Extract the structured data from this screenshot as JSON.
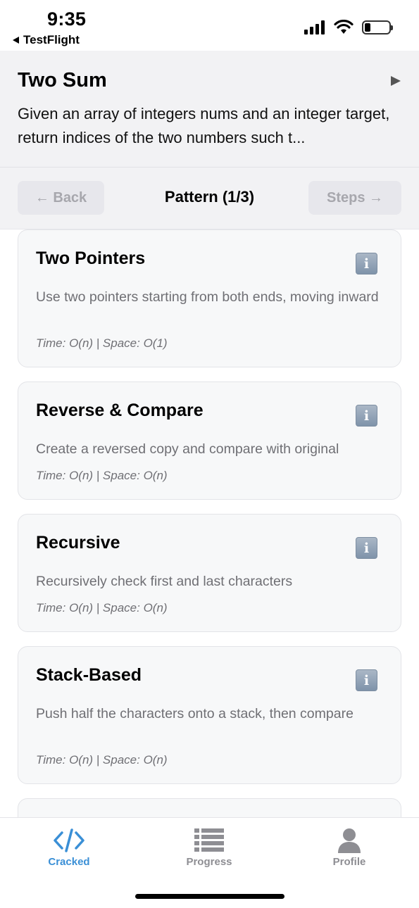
{
  "status_bar": {
    "time": "9:35",
    "back_app_label": "TestFlight",
    "battery_level": 0.25
  },
  "header": {
    "title": "Two Sum",
    "description": "Given an array of integers nums and an integer target, return indices of the two numbers such t..."
  },
  "pattern_nav": {
    "back_label": "← Back",
    "title": "Pattern (1/3)",
    "steps_label": "Steps →"
  },
  "cards": [
    {
      "title": "Two Pointers",
      "description": "Use two pointers starting from both ends, moving inward",
      "complexity": "Time: O(n) | Space: O(1)"
    },
    {
      "title": "Reverse & Compare",
      "description": "Create a reversed copy and compare with original",
      "complexity": "Time: O(n) | Space: O(n)"
    },
    {
      "title": "Recursive",
      "description": "Recursively check first and last characters",
      "complexity": "Time: O(n) | Space: O(n)"
    },
    {
      "title": "Stack-Based",
      "description": "Push half the characters onto a stack, then compare",
      "complexity": "Time: O(n) | Space: O(n)"
    }
  ],
  "info_icon_glyph": "i",
  "tabs": [
    {
      "label": "Cracked",
      "icon": "code-icon",
      "active": true
    },
    {
      "label": "Progress",
      "icon": "list-icon",
      "active": false
    },
    {
      "label": "Profile",
      "icon": "person-icon",
      "active": false
    }
  ],
  "colors": {
    "accent": "#3a8fd6",
    "inactive_tab": "#8e8e93",
    "header_bg": "#f2f2f4"
  }
}
